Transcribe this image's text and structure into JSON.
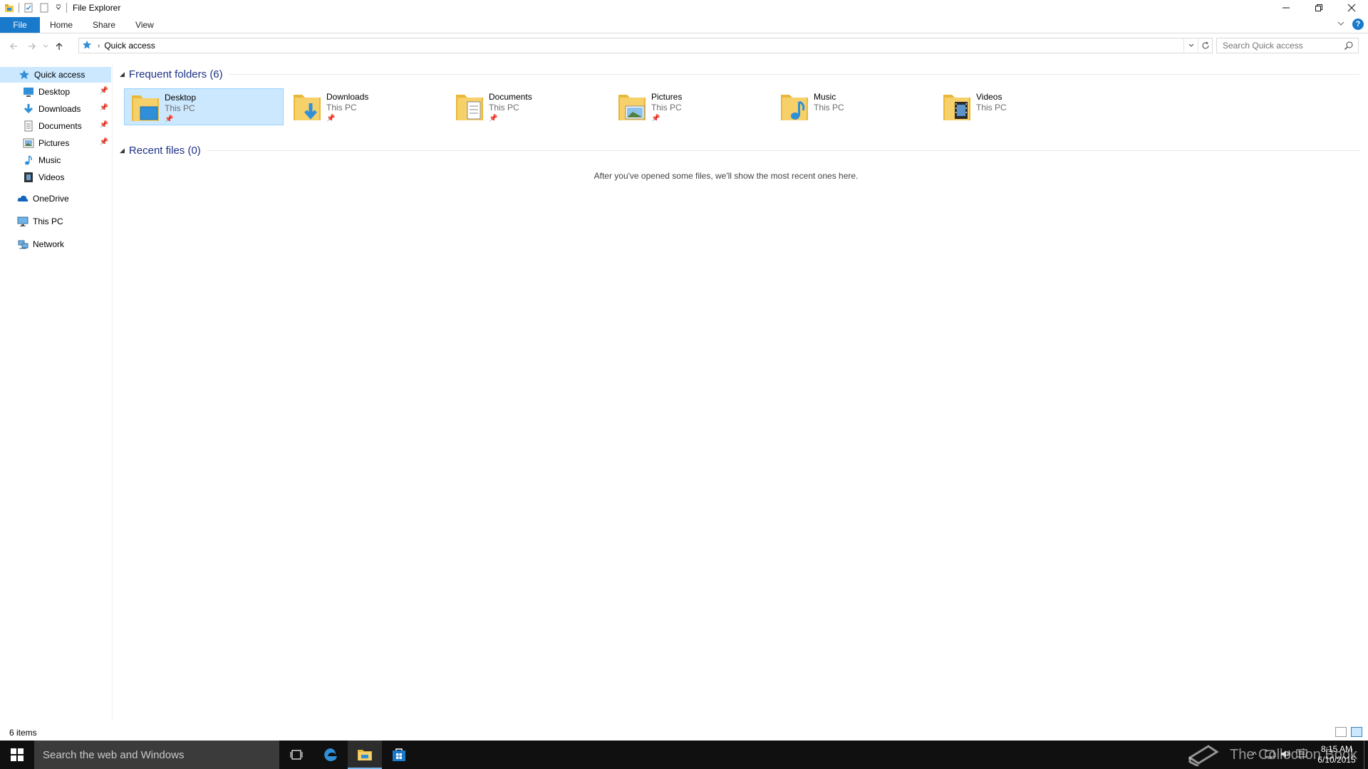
{
  "window": {
    "title": "File Explorer"
  },
  "ribbon": {
    "tabs": [
      "File",
      "Home",
      "Share",
      "View"
    ],
    "help": "?"
  },
  "address": {
    "crumb": "Quick access",
    "search_placeholder": "Search Quick access"
  },
  "nav": {
    "quick_access": "Quick access",
    "pinned": [
      {
        "label": "Desktop",
        "icon": "desktop-icon",
        "pinned": true
      },
      {
        "label": "Downloads",
        "icon": "downloads-icon",
        "pinned": true
      },
      {
        "label": "Documents",
        "icon": "documents-icon",
        "pinned": true
      },
      {
        "label": "Pictures",
        "icon": "pictures-icon",
        "pinned": true
      },
      {
        "label": "Music",
        "icon": "music-icon",
        "pinned": false
      },
      {
        "label": "Videos",
        "icon": "videos-icon",
        "pinned": false
      }
    ],
    "onedrive": "OneDrive",
    "this_pc": "This PC",
    "network": "Network"
  },
  "content": {
    "frequent_header": "Frequent folders (6)",
    "recent_header": "Recent files (0)",
    "empty_message": "After you've opened some files, we'll show the most recent ones here.",
    "folders": [
      {
        "name": "Desktop",
        "location": "This PC",
        "pinned": true,
        "selected": true,
        "icon": "desktop-folder-icon"
      },
      {
        "name": "Downloads",
        "location": "This PC",
        "pinned": true,
        "selected": false,
        "icon": "downloads-folder-icon"
      },
      {
        "name": "Documents",
        "location": "This PC",
        "pinned": true,
        "selected": false,
        "icon": "documents-folder-icon"
      },
      {
        "name": "Pictures",
        "location": "This PC",
        "pinned": true,
        "selected": false,
        "icon": "pictures-folder-icon"
      },
      {
        "name": "Music",
        "location": "This PC",
        "pinned": false,
        "selected": false,
        "icon": "music-folder-icon"
      },
      {
        "name": "Videos",
        "location": "This PC",
        "pinned": false,
        "selected": false,
        "icon": "videos-folder-icon"
      }
    ]
  },
  "status": {
    "item_count": "6 items"
  },
  "taskbar": {
    "search_placeholder": "Search the web and Windows",
    "watermark": "The Collection Book",
    "time": "8:15 AM",
    "date": "6/10/2015"
  },
  "colors": {
    "accent": "#1979ca",
    "selection": "#cce8ff",
    "folder": "#f3c74a",
    "header_text": "#1e3287"
  }
}
